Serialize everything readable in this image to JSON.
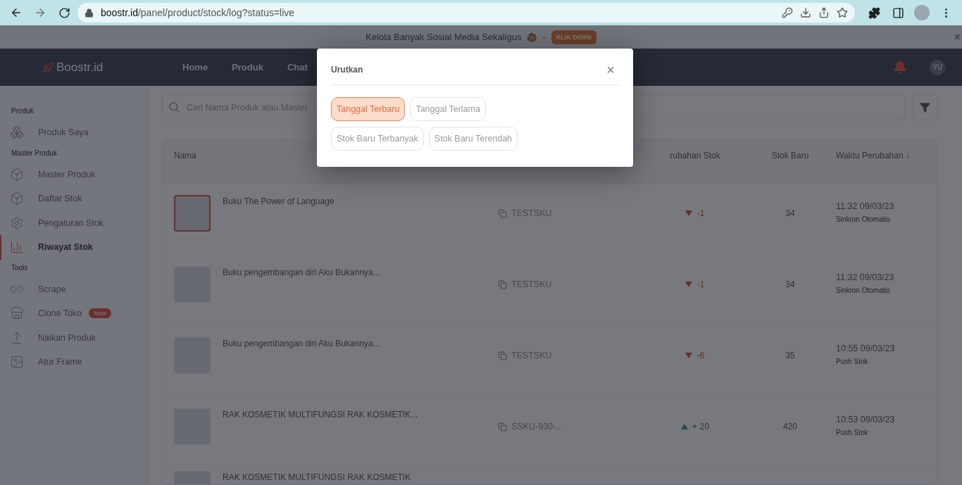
{
  "browser": {
    "url_host": "boostr.id",
    "url_path": "/panel/product/stock/log?status=live"
  },
  "banner": {
    "text": "Kelola Banyak Sosial Media Sekaligus",
    "separator": "-",
    "button": "KLIK DISINI",
    "close": "×"
  },
  "navbar": {
    "logo": "Boostr.id",
    "items": [
      {
        "label": "Home"
      },
      {
        "label": "Produk"
      },
      {
        "label": "Chat"
      }
    ],
    "avatar": "YU"
  },
  "sidebar": {
    "sections": [
      {
        "title": "Produk",
        "items": [
          {
            "label": "Produk Saya",
            "selected": false
          }
        ]
      },
      {
        "title": "Master Produk",
        "items": [
          {
            "label": "Master Produk",
            "selected": false
          },
          {
            "label": "Daftar Stok",
            "selected": false
          },
          {
            "label": "Pengaturan Stok",
            "selected": false
          },
          {
            "label": "Riwayat Stok",
            "selected": true
          }
        ]
      },
      {
        "title": "Tools",
        "items": [
          {
            "label": "Scrape",
            "selected": false
          },
          {
            "label": "Clone Toko",
            "selected": false,
            "badge": "New"
          },
          {
            "label": "Naikan Produk",
            "selected": false
          },
          {
            "label": "Atur Frame",
            "selected": false
          }
        ]
      }
    ]
  },
  "search": {
    "placeholder": "Cari Nama Produk atau Master"
  },
  "table": {
    "columns": [
      {
        "label": "Nama"
      },
      {
        "label": "rubahan Stok"
      },
      {
        "label": "Stok Baru"
      },
      {
        "label": "Waktu Perubahan ↓"
      }
    ],
    "rows": [
      {
        "name": "Buku The Power of Language",
        "sku": "TESTSKU",
        "change": "-1",
        "kind": "down",
        "stock": "34",
        "time": "11:32 09/03/23",
        "source": "Sinkron Otomatis"
      },
      {
        "name": "Buku pengembangan diri Aku Bukannya...",
        "sku": "TESTSKU",
        "change": "-1",
        "kind": "down",
        "stock": "34",
        "time": "11:32 09/03/23",
        "source": "Sinkron Otomatis"
      },
      {
        "name": "Buku pengembangan diri Aku Bukannya...",
        "sku": "TESTSKU",
        "change": "-6",
        "kind": "down",
        "stock": "35",
        "time": "10:55 09/03/23",
        "source": "Push Stok"
      },
      {
        "name": "RAK KOSMETIK MULTIFUNGSI RAK KOSMETIK...",
        "sku": "SSKU-930-...",
        "change": "+ 20",
        "kind": "up",
        "stock": "420",
        "time": "10:53 09/03/23",
        "source": "Push Stok"
      },
      {
        "name": "RAK KOSMETIK MULTIFUNGSI RAK KOSMETIK",
        "kind": "partial"
      }
    ]
  },
  "modal": {
    "title": "Urutkan",
    "close": "×",
    "options": [
      {
        "label": "Tanggal Terbaru",
        "selected": true
      },
      {
        "label": "Tanggal Terlama",
        "selected": false
      },
      {
        "label": "Stok Baru Terbanyak",
        "selected": false
      },
      {
        "label": "Stok Baru Terendah",
        "selected": false
      }
    ]
  }
}
